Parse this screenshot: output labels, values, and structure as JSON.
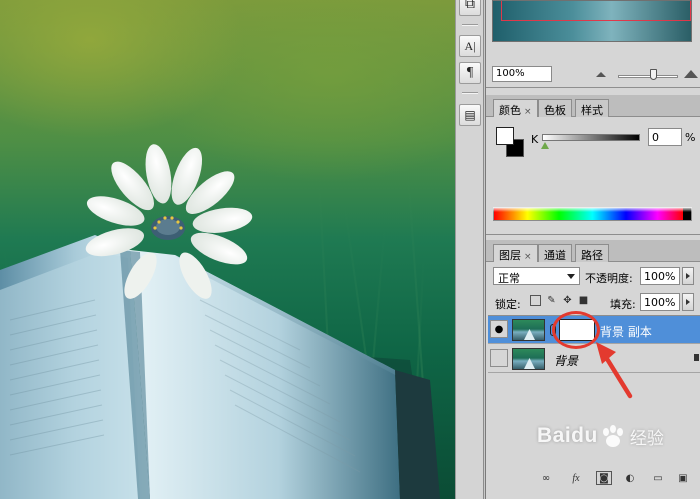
{
  "icons": {
    "toolstrip": [
      "layer-comps-icon",
      "character-icon",
      "paragraph-icon",
      "notes-icon"
    ],
    "toolstrip_glyphs": [
      "⧉",
      "A|",
      "¶",
      "▤"
    ]
  },
  "navigator": {
    "zoom_value": "100%"
  },
  "color_panel": {
    "tabs": [
      {
        "label": "颜色",
        "close": "×"
      },
      {
        "label": "色板"
      },
      {
        "label": "样式"
      }
    ],
    "channel_label": "K",
    "channel_value": "0",
    "channel_unit": "%",
    "foreground_color": "#ffffff",
    "background_color": "#000000"
  },
  "layers_panel": {
    "tabs": [
      {
        "label": "图层",
        "close": "×"
      },
      {
        "label": "通道"
      },
      {
        "label": "路径"
      }
    ],
    "blend_mode": "正常",
    "opacity_label": "不透明度:",
    "opacity_value": "100%",
    "lock_label": "锁定:",
    "fill_label": "填充:",
    "fill_value": "100%",
    "layers": [
      {
        "name": "背景 副本",
        "visible": true,
        "selected": true,
        "has_mask": true
      },
      {
        "name": "背景",
        "visible": false,
        "selected": false,
        "locked": true
      }
    ],
    "footer_glyphs": [
      "∞",
      "fx",
      "◙",
      "◐",
      "▭",
      "▣"
    ]
  },
  "annotation": {
    "color": "#e33a2f"
  },
  "watermark": {
    "brand": "Baidu",
    "suffix": "经验"
  },
  "accent_colors": {
    "selection": "#4f8fd9",
    "navigator_frame": "#e0384a"
  }
}
